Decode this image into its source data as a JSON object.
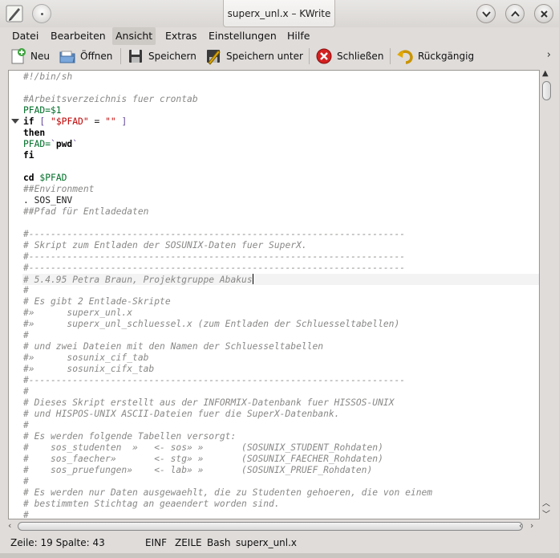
{
  "window": {
    "title": "superx_unl.x – KWrite"
  },
  "menu": {
    "items": [
      "Datei",
      "Bearbeiten",
      "Ansicht",
      "Extras",
      "Einstellungen",
      "Hilfe"
    ],
    "active": "Ansicht"
  },
  "toolbar": {
    "new": "Neu",
    "open": "Öffnen",
    "save": "Speichern",
    "save_as": "Speichern unter",
    "close": "Schließen",
    "undo": "Rückgängig",
    "more": "›"
  },
  "editor": {
    "current_line": 19,
    "lines": [
      [
        [
          "c",
          "#!/bin/sh"
        ]
      ],
      [],
      [
        [
          "c",
          "#Arbeitsverzeichnis fuer crontab"
        ]
      ],
      [
        [
          "v",
          "PFAD=$1"
        ]
      ],
      [
        [
          "k",
          "if"
        ],
        [
          "",
          " "
        ],
        [
          "p",
          "["
        ],
        [
          "",
          " "
        ],
        [
          "s",
          "\"$PFAD\""
        ],
        [
          "",
          " = "
        ],
        [
          "s",
          "\"\""
        ],
        [
          "",
          " "
        ],
        [
          "p",
          "]"
        ]
      ],
      [
        [
          "k",
          "then"
        ]
      ],
      [
        [
          "v",
          "PFAD="
        ],
        [
          "p",
          "`"
        ],
        [
          "k",
          "pwd"
        ],
        [
          "p",
          "`"
        ]
      ],
      [
        [
          "k",
          "fi"
        ]
      ],
      [],
      [
        [
          "k",
          "cd"
        ],
        [
          "",
          " "
        ],
        [
          "v",
          "$PFAD"
        ]
      ],
      [
        [
          "c",
          "##Environment"
        ]
      ],
      [
        [
          "",
          ". SOS_ENV"
        ]
      ],
      [
        [
          "c",
          "##Pfad für Entladedaten"
        ]
      ],
      [],
      [
        [
          "c",
          "#---------------------------------------------------------------------"
        ]
      ],
      [
        [
          "c",
          "# Skript zum Entladen der SOSUNIX-Daten fuer SuperX."
        ]
      ],
      [
        [
          "c",
          "#---------------------------------------------------------------------"
        ]
      ],
      [
        [
          "c",
          "#---------------------------------------------------------------------"
        ]
      ],
      [
        [
          "c",
          "# 5.4.95 Petra Braun, Projektgruppe Abakus"
        ]
      ],
      [
        [
          "c",
          "#"
        ]
      ],
      [
        [
          "c",
          "# Es gibt 2 Entlade-Skripte"
        ]
      ],
      [
        [
          "c",
          "#»      superx_unl.x"
        ]
      ],
      [
        [
          "c",
          "#»      superx_unl_schluessel.x (zum Entladen der Schluesseltabellen)"
        ]
      ],
      [
        [
          "c",
          "#"
        ]
      ],
      [
        [
          "c",
          "# und zwei Dateien mit den Namen der Schluesseltabellen"
        ]
      ],
      [
        [
          "c",
          "#»      sosunix_cif_tab"
        ]
      ],
      [
        [
          "c",
          "#»      sosunix_cifx_tab"
        ]
      ],
      [
        [
          "c",
          "#---------------------------------------------------------------------"
        ]
      ],
      [
        [
          "c",
          "#"
        ]
      ],
      [
        [
          "c",
          "# Dieses Skript erstellt aus der INFORMIX-Datenbank fuer HISSOS-UNIX"
        ]
      ],
      [
        [
          "c",
          "# und HISPOS-UNIX ASCII-Dateien fuer die SuperX-Datenbank."
        ]
      ],
      [
        [
          "c",
          "#"
        ]
      ],
      [
        [
          "c",
          "# Es werden folgende Tabellen versorgt:"
        ]
      ],
      [
        [
          "c",
          "#    sos_studenten  »   <- sos» »       (SOSUNIX_STUDENT_Rohdaten)"
        ]
      ],
      [
        [
          "c",
          "#    sos_faecher»       <- stg» »       (SOSUNIX_FAECHER_Rohdaten)"
        ]
      ],
      [
        [
          "c",
          "#    sos_pruefungen»    <- lab» »       (SOSUNIX_PRUEF_Rohdaten)"
        ]
      ],
      [
        [
          "c",
          "#"
        ]
      ],
      [
        [
          "c",
          "# Es werden nur Daten ausgewaehlt, die zu Studenten gehoeren, die von einem"
        ]
      ],
      [
        [
          "c",
          "# bestimmten Stichtag an geaendert worden sind."
        ]
      ],
      [
        [
          "c",
          "#"
        ]
      ]
    ]
  },
  "statusbar": {
    "position": "Zeile: 19 Spalte: 43",
    "mode": "EINF",
    "selection": "ZEILE",
    "syntax": "Bash",
    "filename": "superx_unl.x"
  },
  "colors": {
    "comment": "#898887",
    "variable": "#006e28",
    "operator": "#644a9b",
    "string": "#bf0303",
    "keyword": "#000000"
  }
}
